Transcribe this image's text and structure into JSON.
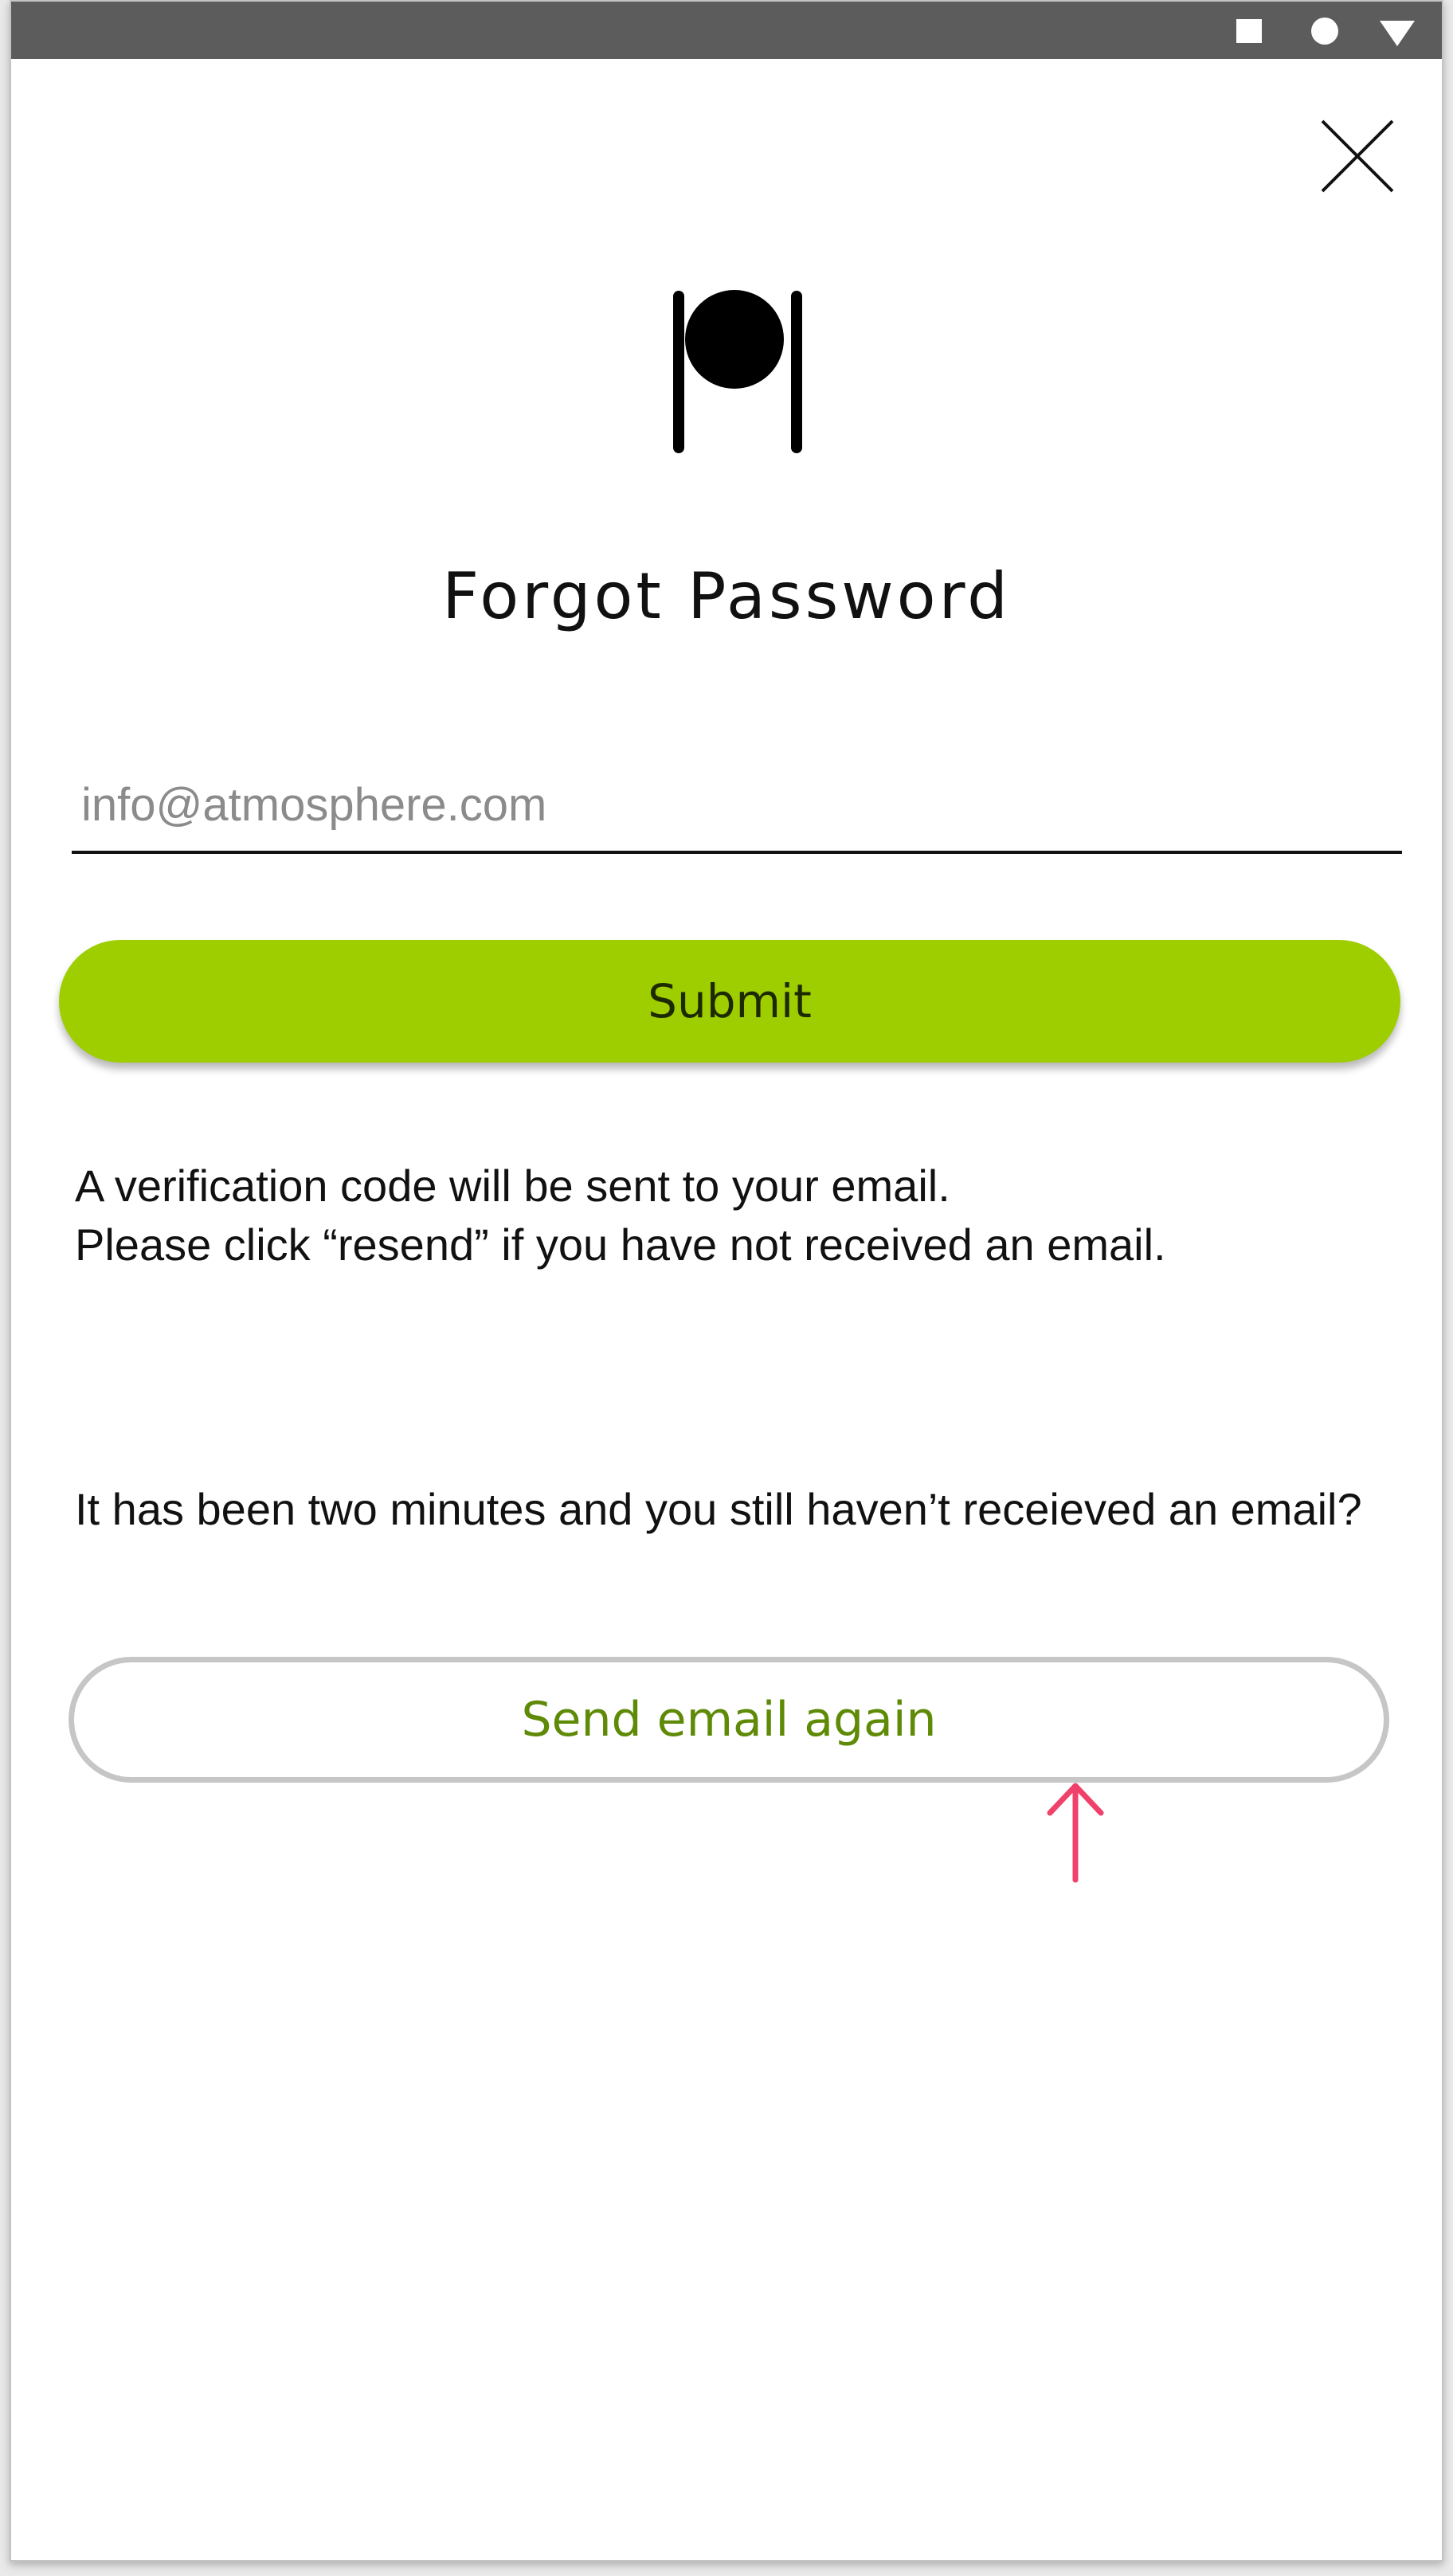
{
  "status_bar": {
    "icons": [
      "square-icon",
      "circle-icon",
      "triangle-icon"
    ]
  },
  "close": {
    "icon": "close-icon"
  },
  "logo": {
    "icon": "atmosphere-logo-icon"
  },
  "title": "Forgot Password",
  "email": {
    "value": "",
    "placeholder": "info@atmosphere.com"
  },
  "submit_label": "Submit",
  "info": {
    "line1": "A verification code will be sent to your email.",
    "line2": "Please click “resend” if you have not received an email."
  },
  "timeout_message": "It has been two minutes and you still haven’t receieved an email?",
  "resend_label": "Send email again",
  "annotation": {
    "icon": "up-arrow-icon",
    "color": "#f0416a"
  },
  "colors": {
    "accent": "#9ece00",
    "resend_text": "#5e8a06",
    "status_bar": "#5c5c5d"
  }
}
